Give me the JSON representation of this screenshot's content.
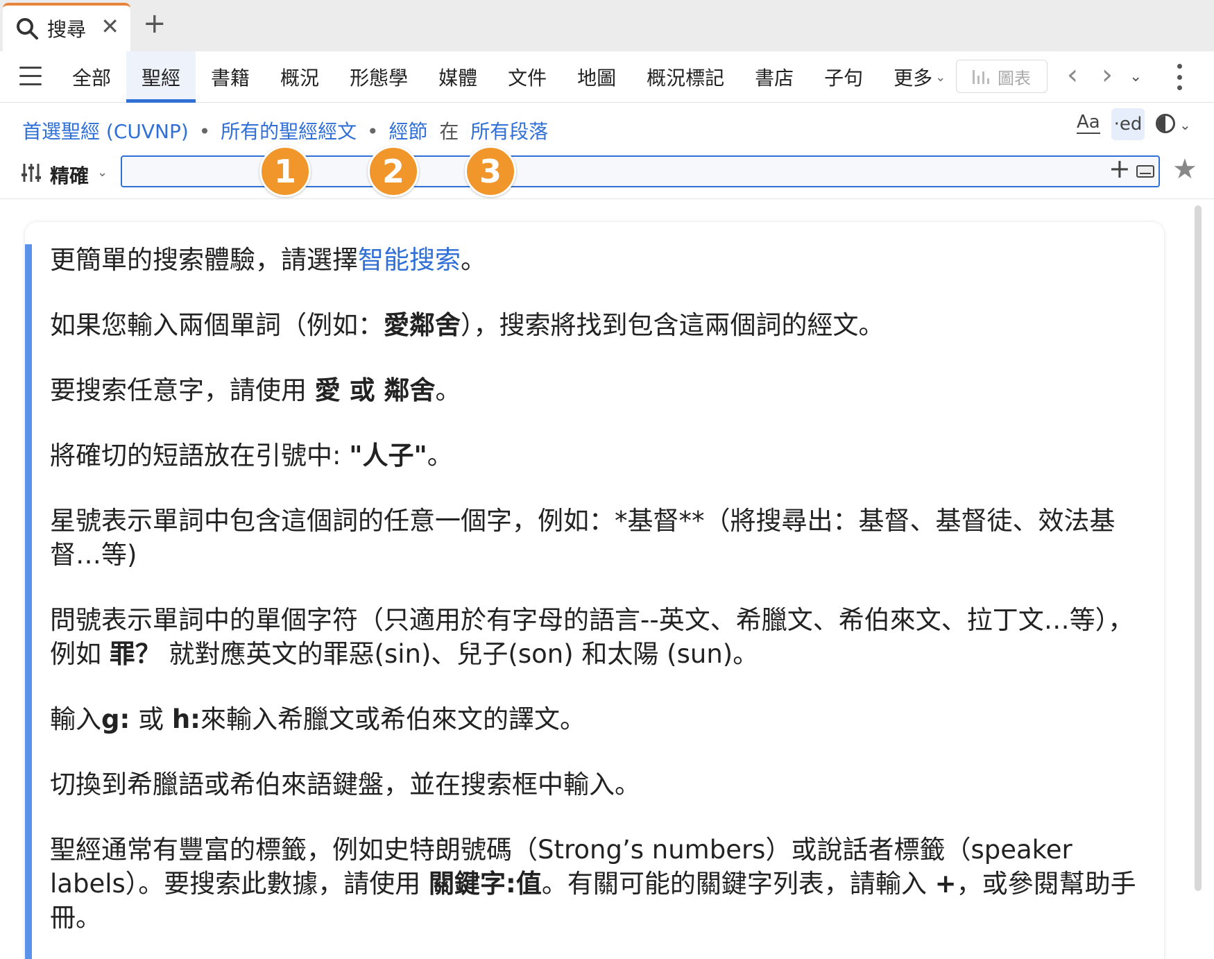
{
  "tab": {
    "title": "搜尋",
    "close": "✕",
    "new_tab": "+"
  },
  "nav": {
    "items": [
      "全部",
      "聖經",
      "書籍",
      "概況",
      "形態學",
      "媒體",
      "文件",
      "地圖",
      "概況標記",
      "書店",
      "子句"
    ],
    "active_index": 1,
    "more_label": "更多",
    "chart_label": "圖表",
    "prev": "‹",
    "next": "›"
  },
  "criteria": {
    "preferred_bible": "首選聖經 (CUVNP)",
    "scope": "所有的聖經經文",
    "unit": "經節",
    "in_word": "在",
    "range": "所有段落",
    "sep": "•"
  },
  "display_buttons": {
    "font": "Aa",
    "ed": "·ed"
  },
  "search": {
    "match_label": "精確",
    "value": "",
    "plus": "+",
    "star": "★"
  },
  "badges": [
    "1",
    "2",
    "3"
  ],
  "help": {
    "p1": {
      "a": "更簡單的搜索體驗，請選擇",
      "link": "智能搜索",
      "b": "。"
    },
    "p2": {
      "a": "如果您輸入兩個單詞（例如：",
      "bold": "愛鄰舍",
      "b": "），搜索將找到包含這兩個詞的經文。"
    },
    "p3": {
      "a": "要搜索任意字，請使用",
      "bold": "愛 或 鄰舍",
      "b": "。"
    },
    "p4": {
      "a": "將確切的短語放在引號中:",
      "bold": "\"人子\"",
      "b": "。"
    },
    "p5": {
      "a": "星號表示單詞中包含這個詞的任意一個字，例如：*基督**（將搜尋出：基督、基督徒、效法基督…等)"
    },
    "p6": {
      "a": "問號表示單詞中的單個字符（只適用於有字母的語言--英文、希臘文、希伯來文、拉丁文…等），例如",
      "bold": "罪？",
      "b": "就對應英文的罪惡(sin)、兒子(son) 和太陽 (sun)。"
    },
    "p7": {
      "a": "輸入",
      "bold1": "g:",
      "mid": "或",
      "bold2": "h:",
      "b": "來輸入希臘文或希伯來文的譯文。"
    },
    "p8": {
      "a": "切換到希臘語或希伯來語鍵盤，並在搜索框中輸入。"
    },
    "p9": {
      "a": "聖經通常有豐富的標籤，例如史特朗號碼（Strong’s numbers）或說話者標籤（speaker labels）。要搜索此數據，請使用",
      "bold": "關鍵字:值",
      "b": "。有關可能的關鍵字列表，請輸入",
      "bold2": "+",
      "c": "，或參閱幫助手冊。"
    }
  },
  "colors": {
    "accent": "#2f6fd6",
    "tab_indicator": "#e8833a",
    "badge": "#f0962a",
    "card_accent": "#5b93ea"
  }
}
